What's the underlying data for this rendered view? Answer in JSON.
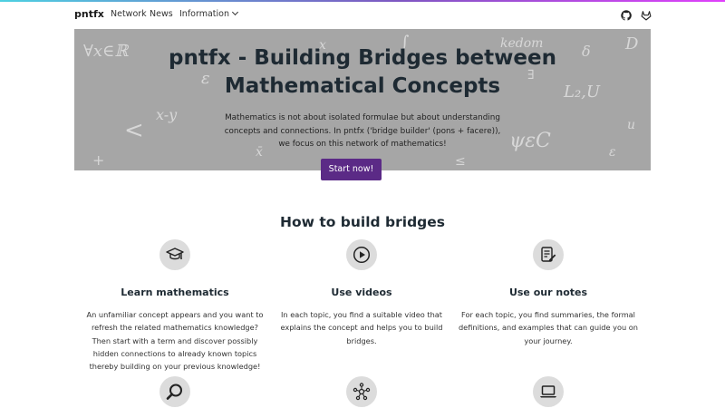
{
  "nav": {
    "brand": "pntfx",
    "links": [
      "Network",
      "News",
      "Information"
    ],
    "icons": [
      "github-icon",
      "gitlab-icon"
    ]
  },
  "hero": {
    "title_line1": "pntfx - Building Bridges between",
    "title_line2": "Mathematical Concepts",
    "lead_line1": "Mathematics is not about isolated formulae but about understanding",
    "lead_line2": "concepts and connections. In pntfx ('bridge builder' (pons + facere)),",
    "lead_line3": "we focus on this network of mathematics!",
    "button": "Start now!",
    "background_math": [
      "∀x∈ℝ",
      "x-y",
      "<",
      "+",
      "ε",
      "δ",
      "ψεC",
      "L₂,U",
      "x̄",
      "≤",
      "ε",
      "D",
      "kedom",
      "∫",
      "x",
      "u",
      "∃"
    ]
  },
  "section": {
    "title": "How to build bridges"
  },
  "features": [
    {
      "icon": "graduation-cap-icon",
      "title": "Learn mathematics",
      "lines": [
        "An unfamiliar concept appears and you want to",
        "refresh the related mathematics knowledge?",
        "Then start with a term and discover possibly",
        "hidden connections to already known topics",
        "thereby building on your previous knowledge!"
      ]
    },
    {
      "icon": "play-icon",
      "title": "Use videos",
      "lines": [
        "In each topic, you find a suitable video that",
        "explains the concept and helps you to build",
        "bridges."
      ]
    },
    {
      "icon": "notes-icon",
      "title": "Use our notes",
      "lines": [
        "For each topic, you find summaries, the formal",
        "definitions, and examples that can guide you on",
        "your journey."
      ]
    }
  ],
  "feature_icons_row2": [
    "magnifier-icon",
    "network-icon",
    "laptop-icon"
  ],
  "colors": {
    "accent_button": "#5b2a86",
    "hero_bg": "#a6a6a6",
    "icon_circle": "#dcdcdc",
    "heading": "#1e2a33"
  }
}
